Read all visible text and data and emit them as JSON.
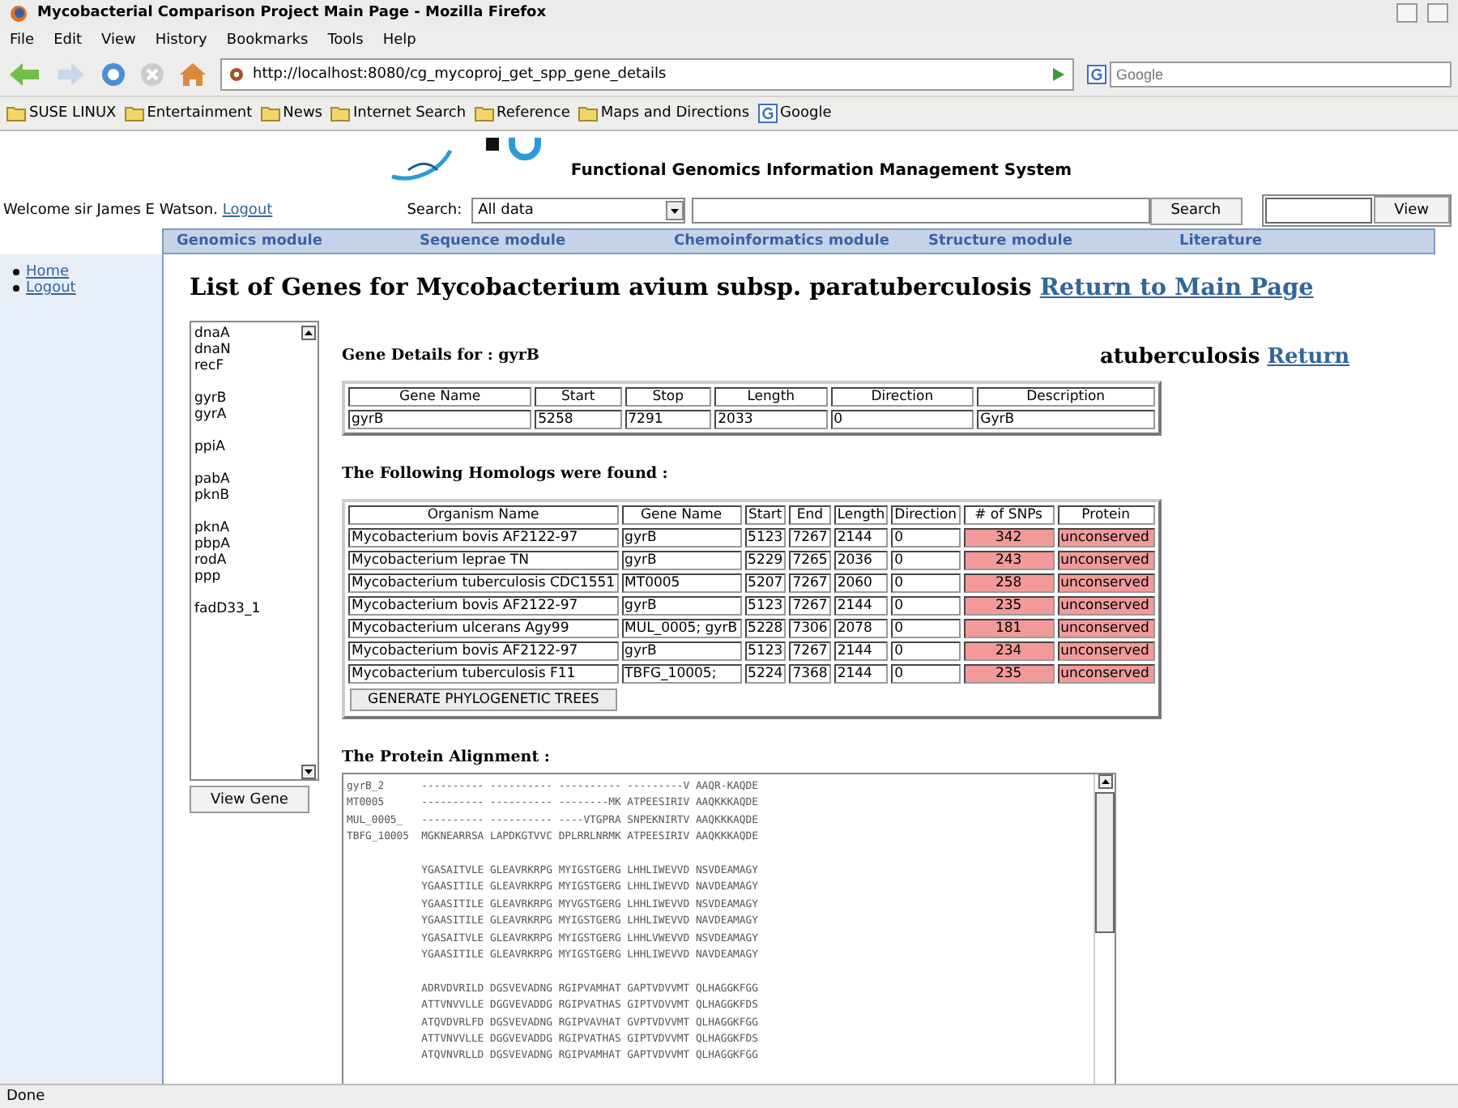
{
  "window": {
    "title": "Mycobacterial Comparison Project Main Page - Mozilla Firefox"
  },
  "menu": [
    "File",
    "Edit",
    "View",
    "History",
    "Bookmarks",
    "Tools",
    "Help"
  ],
  "url": "http://localhost:8080/cg_mycoproj_get_spp_gene_details",
  "search_engine": {
    "placeholder": "Google"
  },
  "bookmarks": [
    {
      "label": "SUSE LINUX",
      "kind": "folder"
    },
    {
      "label": "Entertainment",
      "kind": "folder"
    },
    {
      "label": "News",
      "kind": "folder"
    },
    {
      "label": "Internet Search",
      "kind": "folder"
    },
    {
      "label": "Reference",
      "kind": "folder"
    },
    {
      "label": "Maps and Directions",
      "kind": "folder"
    },
    {
      "label": "Google",
      "kind": "site"
    }
  ],
  "logo": {
    "subtitle": "Functional Genomics Information Management System"
  },
  "welcome": {
    "text": "Welcome sir James E Watson.",
    "link": "Logout"
  },
  "search": {
    "label": "Search:",
    "scope": "All data",
    "button": "Search",
    "view_button": "View"
  },
  "modules": [
    "Genomics module",
    "Sequence module",
    "Chemoinformatics module",
    "Structure module",
    "Literature"
  ],
  "sidebar": [
    "Home",
    "Logout"
  ],
  "heading": {
    "text": "List of Genes for Mycobacterium avium subsp. paratuberculosis",
    "link": "Return to Main Page"
  },
  "ghost_heading": {
    "text": "atuberculosis",
    "link": "Return"
  },
  "gene_list": [
    {
      "label": "dnaA",
      "gap_before": false
    },
    {
      "label": "dnaN",
      "gap_before": false
    },
    {
      "label": "recF",
      "gap_before": false
    },
    {
      "label": "gyrB",
      "gap_before": true
    },
    {
      "label": "gyrA",
      "gap_before": false
    },
    {
      "label": "ppiA",
      "gap_before": true
    },
    {
      "label": "pabA",
      "gap_before": true
    },
    {
      "label": "pknB",
      "gap_before": false
    },
    {
      "label": "pknA",
      "gap_before": true
    },
    {
      "label": "pbpA",
      "gap_before": false
    },
    {
      "label": "rodA",
      "gap_before": false
    },
    {
      "label": "ppp",
      "gap_before": false
    },
    {
      "label": "fadD33_1",
      "gap_before": true
    }
  ],
  "view_gene_button": "View Gene",
  "gene_details": {
    "title": "Gene Details for : gyrB",
    "columns": [
      "Gene Name",
      "Start",
      "Stop",
      "Length",
      "Direction",
      "Description"
    ],
    "row": [
      "gyrB",
      "5258",
      "7291",
      "2033",
      "0",
      "GyrB"
    ]
  },
  "homologs": {
    "title": "The Following Homologs were found :",
    "columns": [
      "Organism Name",
      "Gene Name",
      "Start",
      "End",
      "Length",
      "Direction",
      "# of SNPs",
      "Protein"
    ],
    "rows": [
      [
        "Mycobacterium  bovis AF2122-97",
        "gyrB",
        "5123",
        "7267",
        "2144",
        "0",
        "342",
        "unconserved"
      ],
      [
        "Mycobacterium  leprae TN",
        "gyrB",
        "5229",
        "7265",
        "2036",
        "0",
        "243",
        "unconserved"
      ],
      [
        "Mycobacterium  tuberculosis CDC1551",
        "MT0005",
        "5207",
        "7267",
        "2060",
        "0",
        "258",
        "unconserved"
      ],
      [
        "Mycobacterium  bovis AF2122-97",
        "gyrB",
        "5123",
        "7267",
        "2144",
        "0",
        "235",
        "unconserved"
      ],
      [
        "Mycobacterium  ulcerans Agy99",
        "MUL_0005; gyrB",
        "5228",
        "7306",
        "2078",
        "0",
        "181",
        "unconserved"
      ],
      [
        "Mycobacterium  bovis AF2122-97",
        "gyrB",
        "5123",
        "7267",
        "2144",
        "0",
        "234",
        "unconserved"
      ],
      [
        "Mycobacterium  tuberculosis F11",
        "TBFG_10005;",
        "5224",
        "7368",
        "2144",
        "0",
        "235",
        "unconserved"
      ]
    ],
    "button": "GENERATE PHYLOGENETIC TREES"
  },
  "alignment": {
    "title": "The Protein Alignment :",
    "blocks": [
      [
        "gyrB_2      ---------- ---------- ---------- ---------V AAQR-KAQDE",
        "MT0005      ---------- ---------- --------MK ATPEESIRIV AAQKKKAQDE",
        "MUL_0005_   ---------- ---------- ----VTGPRA SNPEKNIRTV AAQKKKAQDE",
        "TBFG_10005  MGKNEARRSA LAPDKGTVVC DPLRRLNRMK ATPEESIRIV AAQKKKAQDE"
      ],
      [
        "            YGASAITVLE GLEAVRKRPG MYIGSTGERG LHHLIWEVVD NSVDEAMAGY",
        "            YGAASITILE GLEAVRKRPG MYIGSTGERG LHHLIWEVVD NAVDEAMAGY",
        "            YGAASITILE GLEAVRKRPG MYVGSTGERG LHHLIWEVVD NSVDEAMAGY",
        "            YGAASITILE GLEAVRKRPG MYIGSTGERG LHHLIWEVVD NAVDEAMAGY",
        "            YGASAITVLE GLEAVRKRPG MYIGSTGERG LHHLVWEVVD NSVDEAMAGY",
        "            YGAASITILE GLEAVRKRPG MYIGSTGERG LHHLIWEVVD NAVDEAMAGY"
      ],
      [
        "            ADRVDVRILD DGSVEVADNG RGIPVAMHAT GAPTVDVVMT QLHAGGKFGG",
        "            ATTVNVVLLE DGGVEVADDG RGIPVATHAS GIPTVDVVMT QLHAGGKFDS",
        "            ATQVDVRLFD DGSVEVADNG RGIPVAVHAT GVPTVDVVMT QLHAGGKFGG",
        "            ATTVNVVLLE DGGVEVADDG RGIPVATHAS GIPTVDVVMT QLHAGGKFDS",
        "            ATQVNVRLLD DGSVEVADNG RGIPVAMHAT GAPTVDVVMT QLHAGGKFGG"
      ]
    ]
  },
  "status_bar": "Done"
}
